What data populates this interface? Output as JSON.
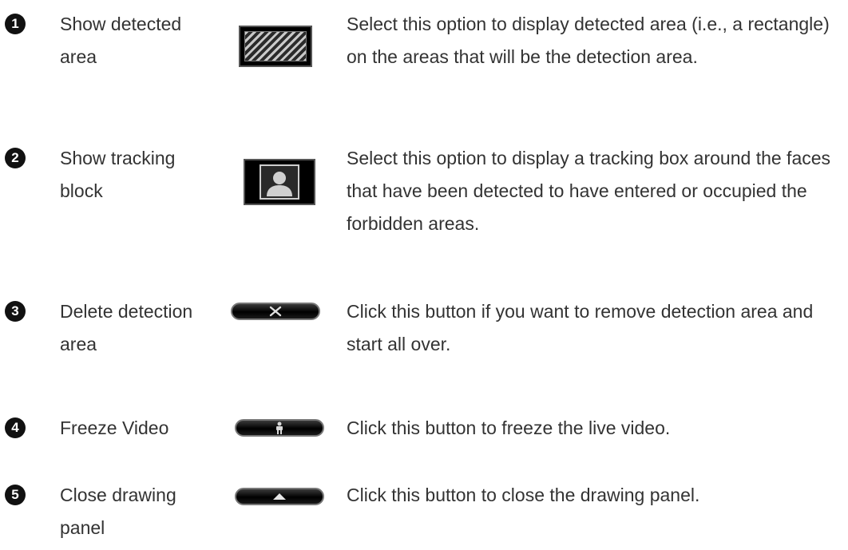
{
  "items": [
    {
      "number": "1",
      "label": "Show detected area",
      "icon": "hatched-area-icon",
      "description": "Select this option to display detected area (i.e., a rectangle) on the areas that will be the detection area."
    },
    {
      "number": "2",
      "label": "Show tracking block",
      "icon": "tracking-block-icon",
      "description": "Select this option to display a tracking box around the faces that have been detected to have entered or occupied the forbidden areas."
    },
    {
      "number": "3",
      "label": "Delete detection area",
      "icon": "delete-x-button-icon",
      "description": "Click this button if you want to remove detection area and start all over."
    },
    {
      "number": "4",
      "label": "Freeze Video",
      "icon": "freeze-person-button-icon",
      "description": "Click this button to freeze the live video."
    },
    {
      "number": "5",
      "label": "Close drawing panel",
      "icon": "close-triangle-button-icon",
      "description": "Click this button to close the drawing panel."
    }
  ],
  "colors": {
    "text": "#333333",
    "badge": "#111111",
    "icon_bg": "#000000"
  }
}
